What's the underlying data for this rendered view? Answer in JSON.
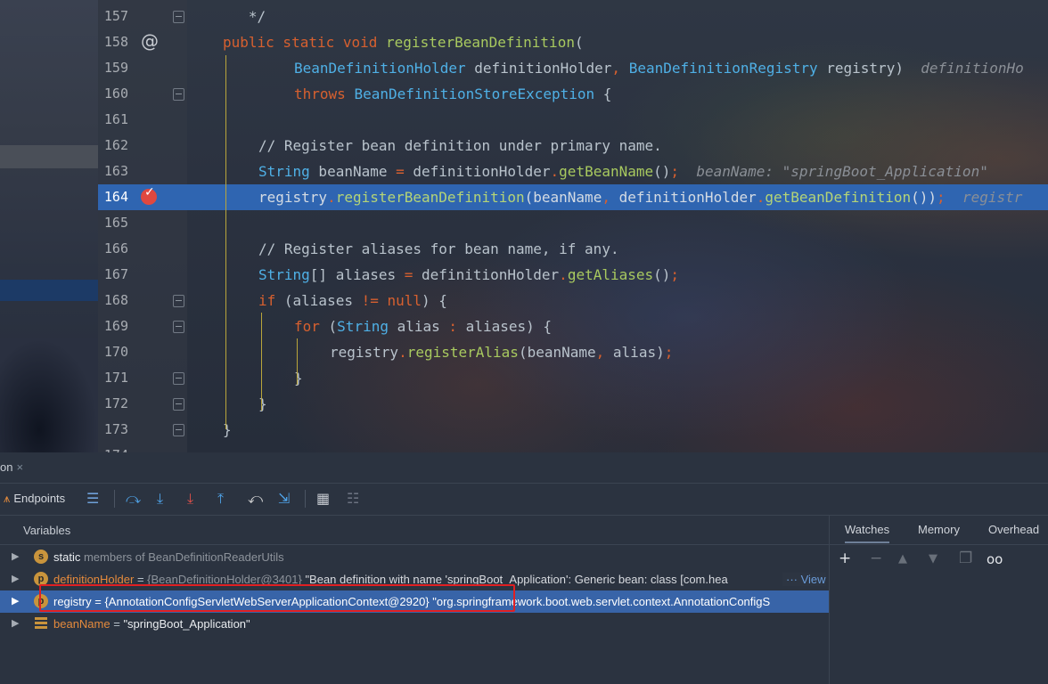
{
  "editor": {
    "lines": [
      {
        "no": "157",
        "text": "   */"
      },
      {
        "no": "158",
        "text": "public static void registerBeanDefinition("
      },
      {
        "no": "159",
        "text": "BeanDefinitionHolder definitionHolder, BeanDefinitionRegistry registry)",
        "hint": "definitionHo"
      },
      {
        "no": "160",
        "text": "throws BeanDefinitionStoreException {"
      },
      {
        "no": "161",
        "text": ""
      },
      {
        "no": "162",
        "text": "// Register bean definition under primary name."
      },
      {
        "no": "163",
        "text": "String beanName = definitionHolder.getBeanName();",
        "hint": "beanName: \"springBoot_Application\""
      },
      {
        "no": "164",
        "text": "registry.registerBeanDefinition(beanName, definitionHolder.getBeanDefinition());",
        "hint": "registr"
      },
      {
        "no": "165",
        "text": ""
      },
      {
        "no": "166",
        "text": "// Register aliases for bean name, if any."
      },
      {
        "no": "167",
        "text": "String[] aliases = definitionHolder.getAliases();"
      },
      {
        "no": "168",
        "text": "if (aliases != null) {"
      },
      {
        "no": "169",
        "text": "for (String alias : aliases) {"
      },
      {
        "no": "170",
        "text": "registry.registerAlias(beanName, alias);"
      },
      {
        "no": "171",
        "text": "}"
      },
      {
        "no": "172",
        "text": "}"
      },
      {
        "no": "173",
        "text": "}"
      },
      {
        "no": "174",
        "text": ""
      }
    ]
  },
  "debug": {
    "tab_title": "on",
    "endpoints_label": "Endpoints",
    "variables_header": "Variables",
    "variables": [
      {
        "badge": "s",
        "name": "static",
        "rest": "members of BeanDefinitionReaderUtils"
      },
      {
        "badge": "p",
        "name": "definitionHolder",
        "eq": " = ",
        "ref": "{BeanDefinitionHolder@3401}",
        "value": " \"Bean definition with name 'springBoot_Application': Generic bean: class [com.hea",
        "more": "··· View"
      },
      {
        "badge": "p",
        "name": "registry",
        "eq": " = ",
        "ref": "{AnnotationConfigServletWebServerApplicationContext@2920}",
        "value": " \"org.springframework.boot.web.servlet.context.AnnotationConfigS"
      },
      {
        "badge": "list",
        "name": "beanName",
        "eq": " = ",
        "value": "\"springBoot_Application\""
      }
    ],
    "watches_tabs": [
      "Watches",
      "Memory",
      "Overhead"
    ]
  },
  "colors": {
    "highlight_line": "#2f65b1",
    "selected_row": "#3864a8",
    "annotation_box": "#e11f22",
    "keyword": "#d7602f",
    "type": "#4fb0e6",
    "method": "#a8c95f"
  }
}
